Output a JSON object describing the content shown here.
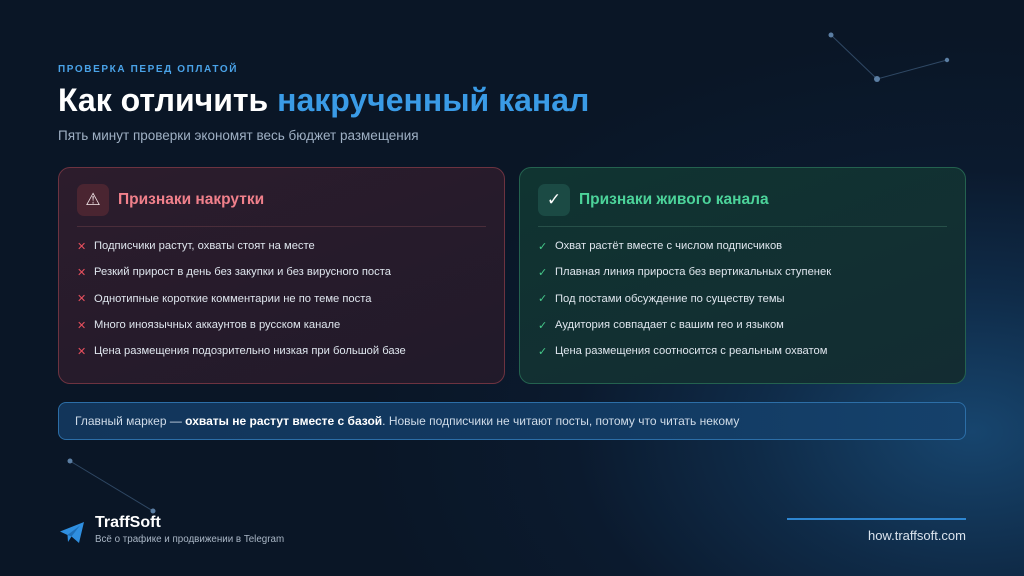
{
  "header": {
    "eyebrow": "ПРОВЕРКА ПЕРЕД ОПЛАТОЙ",
    "title_main": "Как отличить ",
    "title_accent": "накрученный канал",
    "subtitle": "Пять минут проверки экономят весь бюджет размещения"
  },
  "bad_card": {
    "icon": "warning-icon",
    "title": "Признаки накрутки",
    "mark": "✕",
    "items": [
      "Подписчики растут, охваты стоят на месте",
      "Резкий прирост в день без закупки и без вирусного поста",
      "Однотипные короткие комментарии не по теме поста",
      "Много иноязычных аккаунтов в русском канале",
      "Цена размещения подозрительно низкая при большой базе"
    ],
    "accent_color": "#f0808b"
  },
  "good_card": {
    "icon": "check-icon",
    "title": "Признаки живого канала",
    "mark": "✓",
    "items": [
      "Охват растёт вместе с числом подписчиков",
      "Плавная линия прироста без вертикальных ступенек",
      "Под постами обсуждение по существу темы",
      "Аудитория совпадает с вашим гео и языком",
      "Цена размещения соотносится с реальным охватом"
    ],
    "accent_color": "#4cd39a"
  },
  "banner": {
    "prefix": "Главный маркер — ",
    "bold": "охваты не растут вместе с базой",
    "suffix": ". Новые подписчики не читают посты, потому что читать некому"
  },
  "footer": {
    "brand_name": "TraffSoft",
    "brand_tagline": "Всё о трафике и продвижении в Telegram",
    "site": "how.traffsoft.com",
    "logo_icon": "telegram-plane-icon"
  },
  "colors": {
    "accent_blue": "#3a9be6",
    "background": "#0b1a2e"
  }
}
